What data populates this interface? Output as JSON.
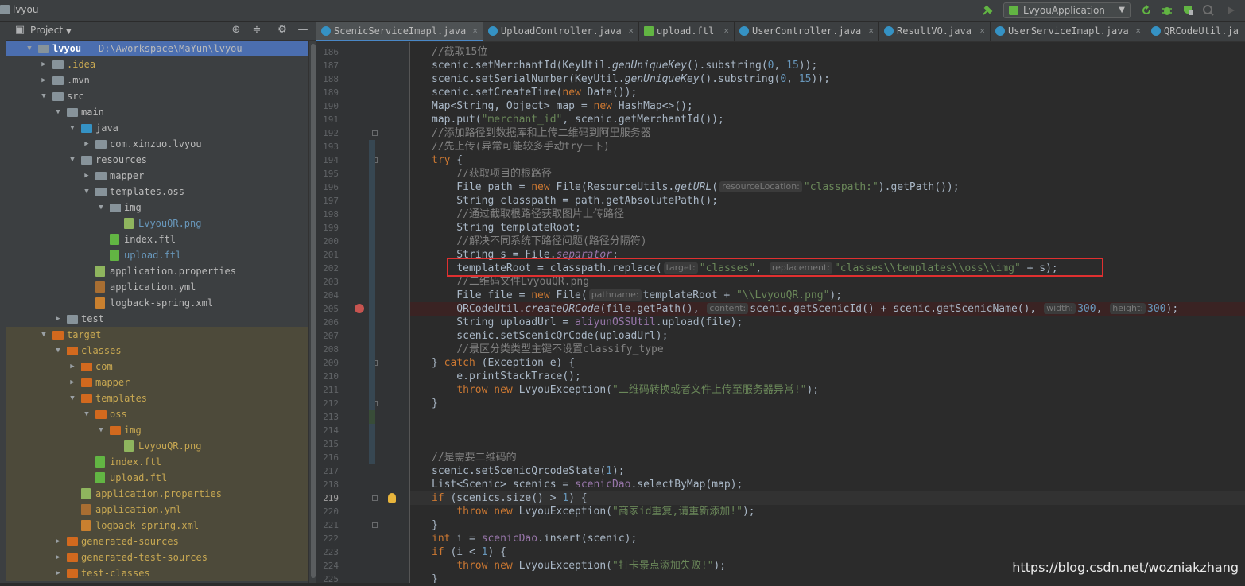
{
  "window": {
    "title": "lvyou"
  },
  "toolbar": {
    "run_config": "LvyouApplication"
  },
  "project_panel": {
    "title": "Project"
  },
  "tree": [
    {
      "depth": 0,
      "arrow": "open",
      "kind": "module",
      "label": "lvyou",
      "path": "D:\\Aworkspace\\MaYun\\lvyou",
      "selected": true
    },
    {
      "depth": 1,
      "arrow": "closed",
      "kind": "folder",
      "label": ".idea",
      "style": "gold"
    },
    {
      "depth": 1,
      "arrow": "closed",
      "kind": "folder",
      "label": ".mvn"
    },
    {
      "depth": 1,
      "arrow": "open",
      "kind": "folder",
      "label": "src"
    },
    {
      "depth": 2,
      "arrow": "open",
      "kind": "folder",
      "label": "main"
    },
    {
      "depth": 3,
      "arrow": "open",
      "kind": "folder-blue",
      "label": "java"
    },
    {
      "depth": 4,
      "arrow": "closed",
      "kind": "package",
      "label": "com.xinzuo.lvyou"
    },
    {
      "depth": 3,
      "arrow": "open",
      "kind": "folder-res",
      "label": "resources"
    },
    {
      "depth": 4,
      "arrow": "closed",
      "kind": "package",
      "label": "mapper"
    },
    {
      "depth": 4,
      "arrow": "open",
      "kind": "package",
      "label": "templates.oss"
    },
    {
      "depth": 5,
      "arrow": "open",
      "kind": "package",
      "label": "img"
    },
    {
      "depth": 6,
      "arrow": "none",
      "kind": "png",
      "label": "LvyouQR.png",
      "style": "link"
    },
    {
      "depth": 5,
      "arrow": "none",
      "kind": "ftl",
      "label": "index.ftl"
    },
    {
      "depth": 5,
      "arrow": "none",
      "kind": "ftl",
      "label": "upload.ftl",
      "style": "link"
    },
    {
      "depth": 4,
      "arrow": "none",
      "kind": "props",
      "label": "application.properties"
    },
    {
      "depth": 4,
      "arrow": "none",
      "kind": "yml",
      "label": "application.yml"
    },
    {
      "depth": 4,
      "arrow": "none",
      "kind": "xml",
      "label": "logback-spring.xml"
    },
    {
      "depth": 2,
      "arrow": "closed",
      "kind": "folder",
      "label": "test"
    },
    {
      "depth": 1,
      "arrow": "open",
      "kind": "folder-orange",
      "label": "target",
      "target": true
    },
    {
      "depth": 2,
      "arrow": "open",
      "kind": "folder-orange",
      "label": "classes",
      "target": true
    },
    {
      "depth": 3,
      "arrow": "closed",
      "kind": "folder-orange",
      "label": "com",
      "target": true
    },
    {
      "depth": 3,
      "arrow": "closed",
      "kind": "folder-orange",
      "label": "mapper",
      "target": true
    },
    {
      "depth": 3,
      "arrow": "open",
      "kind": "folder-orange",
      "label": "templates",
      "target": true
    },
    {
      "depth": 4,
      "arrow": "open",
      "kind": "folder-orange",
      "label": "oss",
      "target": true
    },
    {
      "depth": 5,
      "arrow": "open",
      "kind": "folder-orange",
      "label": "img",
      "target": true
    },
    {
      "depth": 6,
      "arrow": "none",
      "kind": "png",
      "label": "LvyouQR.png",
      "target": true
    },
    {
      "depth": 4,
      "arrow": "none",
      "kind": "ftl",
      "label": "index.ftl",
      "target": true
    },
    {
      "depth": 4,
      "arrow": "none",
      "kind": "ftl",
      "label": "upload.ftl",
      "target": true
    },
    {
      "depth": 3,
      "arrow": "none",
      "kind": "props",
      "label": "application.properties",
      "target": true
    },
    {
      "depth": 3,
      "arrow": "none",
      "kind": "yml",
      "label": "application.yml",
      "target": true
    },
    {
      "depth": 3,
      "arrow": "none",
      "kind": "xml",
      "label": "logback-spring.xml",
      "target": true
    },
    {
      "depth": 2,
      "arrow": "closed",
      "kind": "folder-orange",
      "label": "generated-sources",
      "target": true
    },
    {
      "depth": 2,
      "arrow": "closed",
      "kind": "folder-orange",
      "label": "generated-test-sources",
      "target": true
    },
    {
      "depth": 2,
      "arrow": "closed",
      "kind": "folder-orange",
      "label": "test-classes",
      "target": true
    }
  ],
  "tabs": [
    {
      "label": "ScenicServiceImapl.java",
      "icon": "class",
      "active": true,
      "close": "×"
    },
    {
      "label": "UploadController.java",
      "icon": "class",
      "close": "×"
    },
    {
      "label": "upload.ftl",
      "icon": "ftl",
      "close": "×"
    },
    {
      "label": "UserController.java",
      "icon": "class",
      "close": "×"
    },
    {
      "label": "ResultVO.java",
      "icon": "class",
      "close": "×"
    },
    {
      "label": "UserServiceImapl.java",
      "icon": "class",
      "close": "×"
    },
    {
      "label": "QRCodeUtil.ja",
      "icon": "class"
    }
  ],
  "editor": {
    "highlight_box_line": 202,
    "breakpoint_line": 205,
    "bulb_line": 219,
    "lines": [
      {
        "n": "186",
        "html": "<span class='cm'>//截取15位</span>"
      },
      {
        "n": "187",
        "html": "scenic.setMerchantId(KeyUtil.<span class='fn'>genUniqueKey</span>().substring(<span class='num'>0</span>, <span class='num'>15</span>));"
      },
      {
        "n": "188",
        "html": "scenic.setSerialNumber(KeyUtil.<span class='fn'>genUniqueKey</span>().substring(<span class='num'>0</span>, <span class='num'>15</span>));"
      },
      {
        "n": "189",
        "html": "scenic.setCreateTime(<span class='kw'>new</span> Date());"
      },
      {
        "n": "190",
        "html": "Map&lt;String, Object&gt; map = <span class='kw'>new</span> HashMap&lt;&gt;();"
      },
      {
        "n": "191",
        "html": "map.put(<span class='str'>\"merchant_id\"</span>, scenic.getMerchantId());"
      },
      {
        "n": "192",
        "html": "<span class='cm'>//添加路径到数据库和上传二维码到阿里服务器</span>"
      },
      {
        "n": "193",
        "html": "<span class='cm'>//先上传(异常可能较多手动try一下)</span>"
      },
      {
        "n": "194",
        "html": "<span class='kw'>try</span> {"
      },
      {
        "n": "195",
        "html": "    <span class='cm'>//获取项目的根路径</span>"
      },
      {
        "n": "196",
        "html": "    File path = <span class='kw'>new</span> File(ResourceUtils.<span class='fn'>getURL</span>(<span class='hint'>resourceLocation:</span><span class='str'>\"classpath:\"</span>).getPath());"
      },
      {
        "n": "197",
        "html": "    String classpath = path.getAbsolutePath();"
      },
      {
        "n": "198",
        "html": "    <span class='cm'>//通过截取根路径获取图片上传路径</span>"
      },
      {
        "n": "199",
        "html": "    String templateRoot;"
      },
      {
        "n": "200",
        "html": "    <span class='cm'>//解决不同系统下路径问题(路径分隔符)</span>"
      },
      {
        "n": "201",
        "html": "    String s = File.<span class='sfld'>separator</span>;"
      },
      {
        "n": "202",
        "html": "    templateRoot = classpath.replace(<span class='hint'>target:</span><span class='str'>\"classes\"</span>, <span class='hint'>replacement:</span><span class='str'>\"classes\\\\templates\\\\oss\\\\img\"</span> + s);"
      },
      {
        "n": "203",
        "html": "    <span class='cm'>//二维码文件LvyouQR.png</span>"
      },
      {
        "n": "204",
        "html": "    File file = <span class='kw'>new</span> File(<span class='hint'>pathname:</span>templateRoot + <span class='str'>\"\\\\LvyouQR.png\"</span>);"
      },
      {
        "n": "205",
        "html": "    QRCodeUtil.<span class='fn'>createQRCode</span>(file.getPath(), <span class='hint'>content:</span>scenic.getScenicId() + scenic.getScenicName(), <span class='hint'>width:</span><span class='num'>300</span>, <span class='hint'>height:</span><span class='num'>300</span>);"
      },
      {
        "n": "206",
        "html": "    String uploadUrl = <span class='fld'>aliyunOSSUtil</span>.upload(file);"
      },
      {
        "n": "207",
        "html": "    scenic.setScenicQrCode(uploadUrl);"
      },
      {
        "n": "208",
        "html": "    <span class='cm'>//景区分类类型主键不设置classify_type</span>"
      },
      {
        "n": "209",
        "html": "} <span class='kw'>catch</span> (Exception e) {"
      },
      {
        "n": "210",
        "html": "    e.printStackTrace();"
      },
      {
        "n": "211",
        "html": "    <span class='kw'>throw new</span> LvyouException(<span class='str'>\"二维码转换或者文件上传至服务器异常!\"</span>);"
      },
      {
        "n": "212",
        "html": "}"
      },
      {
        "n": "213",
        "html": ""
      },
      {
        "n": "214",
        "html": ""
      },
      {
        "n": "215",
        "html": ""
      },
      {
        "n": "216",
        "html": "<span class='cm'>//是需要二维码的</span>"
      },
      {
        "n": "217",
        "html": "scenic.setScenicQrcodeState(<span class='num'>1</span>);"
      },
      {
        "n": "218",
        "html": "List&lt;Scenic&gt; scenics = <span class='fld'>scenicDao</span>.selectByMap(map);"
      },
      {
        "n": "219",
        "html": "<span class='kw'>if</span> (scenics.size() &gt; <span class='num'>1</span>) {"
      },
      {
        "n": "220",
        "html": "    <span class='kw'>throw new</span> LvyouException(<span class='str'>\"商家id重复,请重新添加!\"</span>);"
      },
      {
        "n": "221",
        "html": "}"
      },
      {
        "n": "222",
        "html": "<span class='kw'>int</span> i = <span class='fld'>scenicDao</span>.insert(scenic);"
      },
      {
        "n": "223",
        "html": "<span class='kw'>if</span> (i &lt; <span class='num'>1</span>) {"
      },
      {
        "n": "224",
        "html": "    <span class='kw'>throw new</span> LvyouException(<span class='str'>\"打卡景点添加失败!\"</span>);"
      },
      {
        "n": "225",
        "html": "}"
      }
    ]
  },
  "watermark": "https://blog.csdn.net/wozniakzhang",
  "colors": {
    "accent": "#4a88c7",
    "selection": "#4b6eaf",
    "breakpoint": "#c75450",
    "highlight_box": "#e03030"
  }
}
